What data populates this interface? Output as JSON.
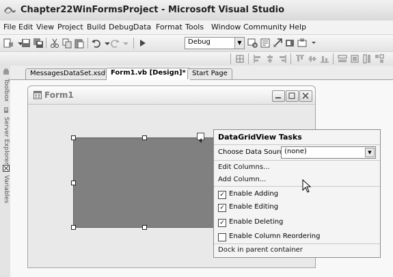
{
  "window": {
    "title": "Chapter22WinFormsProject - Microsoft Visual Studio"
  },
  "menu": [
    "File",
    "Edit",
    "View",
    "Project",
    "Build",
    "Debug",
    "Data",
    "Format",
    "Tools",
    "Window",
    "Community",
    "Help"
  ],
  "toolbar": {
    "configuration": "Debug"
  },
  "tool_rail": {
    "items": [
      "Toolbox",
      "Server Explorer",
      "Variables"
    ]
  },
  "tabs": [
    {
      "label": "MessagesDataSet.xsd*",
      "active": false
    },
    {
      "label": "Form1.vb [Design]*",
      "active": true
    },
    {
      "label": "Start Page",
      "active": false
    }
  ],
  "form": {
    "title": "Form1"
  },
  "tasks": {
    "title": "DataGridView Tasks",
    "data_source_label": "Choose Data Source",
    "data_source_value": "(none)",
    "edit_columns": "Edit Columns...",
    "add_column": "Add Column...",
    "enable_adding": {
      "label": "Enable Adding",
      "checked": true
    },
    "enable_editing": {
      "label": "Enable Editing",
      "checked": true
    },
    "enable_deleting": {
      "label": "Enable Deleting",
      "checked": true
    },
    "enable_reordering": {
      "label": "Enable Column Reordering",
      "checked": false
    },
    "dock": "Dock in parent container"
  },
  "icons": {
    "app": "visual-studio-icon",
    "form": "form-icon",
    "cursor": "mouse-pointer-icon"
  }
}
